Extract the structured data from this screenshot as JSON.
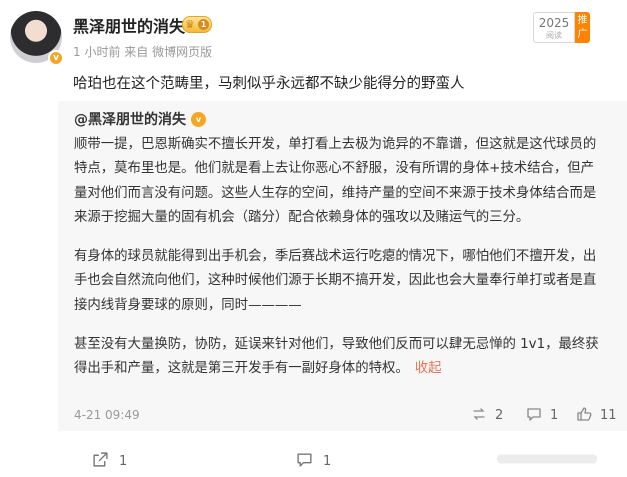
{
  "post": {
    "author": "黑泽朋世的消失",
    "member_level": "1",
    "time": "1 小时前",
    "source": "来自 微博网页版",
    "year_badge": "2025",
    "year_badge_sub": "阅读",
    "push_label": "推广",
    "text": "哈珀也在这个范畴里，马刺似乎永远都不缺少能得分的野蛮人"
  },
  "repost": {
    "author": "@黑泽朋世的消失",
    "paragraphs": [
      "顺带一提，巴恩斯确实不擅长开发，单打看上去极为诡异的不靠谱，但这就是这代球员的特点，莫布里也是。他们就是看上去让你恶心不舒服，没有所谓的身体+技术结合，但产量对他们而言没有问题。这些人生存的空间，维持产量的空间不来源于技术身体结合而是来源于挖掘大量的固有机会（踏分）配合依赖身体的强攻以及赌运气的三分。",
      "有身体的球员就能得到出手机会，季后赛战术运行吃瘪的情况下，哪怕他们不擅开发，出手也会自然流向他们，这种时候他们源于长期不搞开发，因此也会大量奉行单打或者是直接内线背身要球的原则，同时————",
      "甚至没有大量换防，协防，延误来针对他们，导致他们反而可以肆无忌惮的 1v1，最终获得出手和产量，这就是第三开发手有一副好身体的特权。"
    ],
    "collapse_label": "收起",
    "date": "4-21 09:49",
    "reposts": "2",
    "comments": "1",
    "likes": "11"
  },
  "actions": {
    "reposts": "1",
    "comments": "1"
  },
  "colors": {
    "accent_orange": "#ff8200",
    "link_orange": "#eb7350",
    "verified_gold": "#f6a623"
  }
}
